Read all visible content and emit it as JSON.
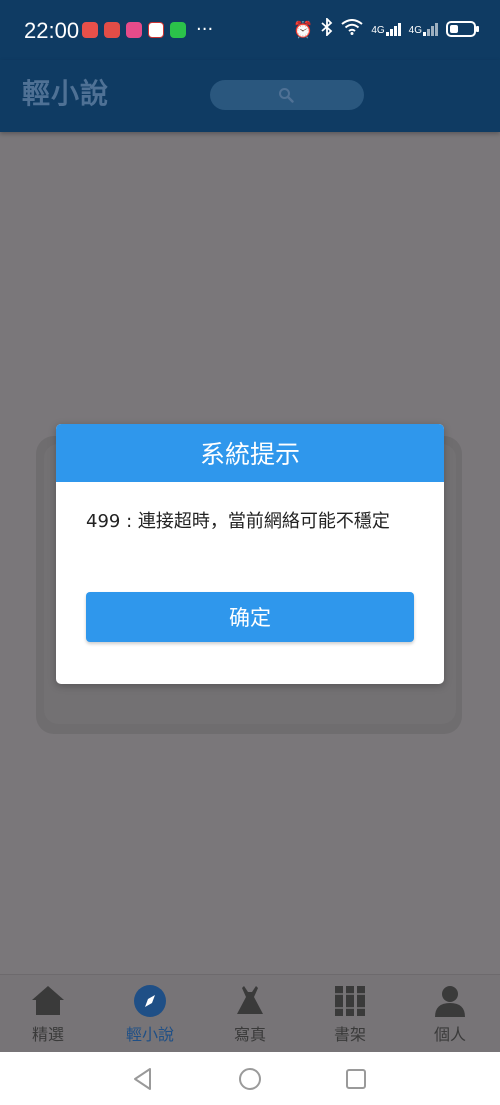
{
  "status_bar": {
    "time": "22:00",
    "network_1": "4G",
    "network_2": "4G"
  },
  "app_bar": {
    "title": "輕小說"
  },
  "dialog": {
    "title": "系統提示",
    "message": "499 : 連接超時，當前網絡可能不穩定",
    "confirm_label": "确定"
  },
  "tabs": [
    {
      "label": "精選",
      "icon": "home-icon",
      "active": false
    },
    {
      "label": "輕小說",
      "icon": "compass-icon",
      "active": true
    },
    {
      "label": "寫真",
      "icon": "dress-icon",
      "active": false
    },
    {
      "label": "書架",
      "icon": "bookshelf-icon",
      "active": false
    },
    {
      "label": "個人",
      "icon": "person-icon",
      "active": false
    }
  ],
  "colors": {
    "app_bar": "#0f3b63",
    "dialog_accent": "#2f97ec",
    "active_tab": "#1f4f86",
    "overlay": "#7a777a"
  }
}
